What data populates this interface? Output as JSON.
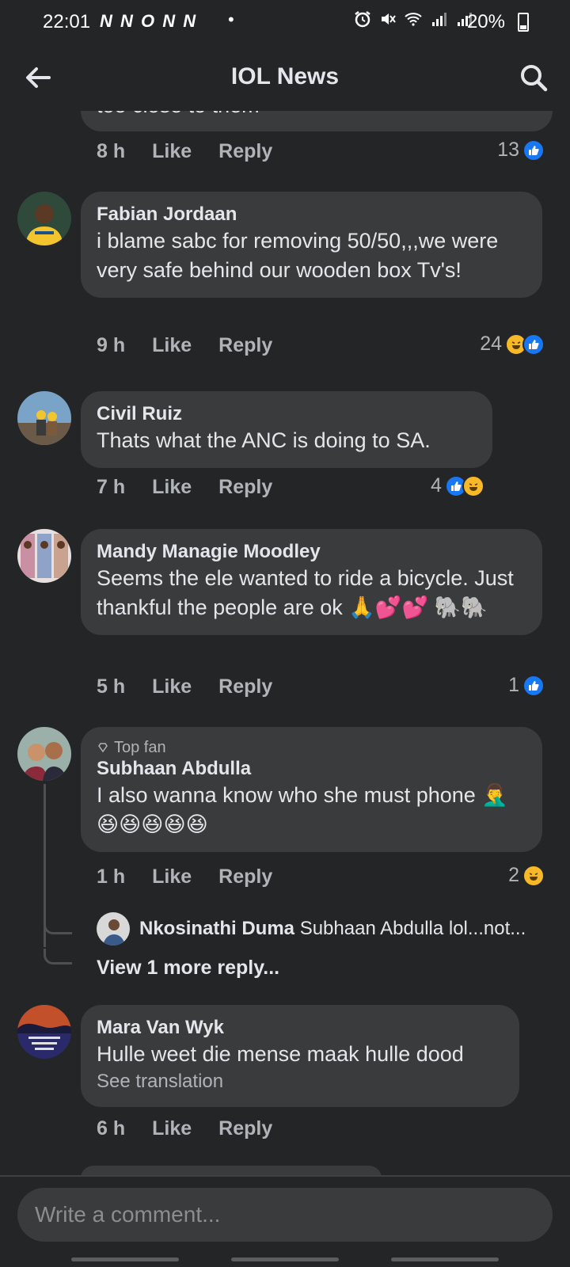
{
  "status_bar": {
    "time": "22:01",
    "app_icons": "N N O N N",
    "dot": "•",
    "battery_percent": "20%"
  },
  "header": {
    "title": "IOL News"
  },
  "partial_comment": {
    "text_fragment": "too close to them",
    "time": "8 h",
    "like_label": "Like",
    "reply_label": "Reply",
    "reaction_count": "13",
    "reactions": [
      "like"
    ]
  },
  "comments": [
    {
      "author": "Fabian Jordaan",
      "text": "i blame sabc for removing 50/50,,,we were very safe behind our wooden box Tv's!",
      "time": "9 h",
      "like_label": "Like",
      "reply_label": "Reply",
      "reaction_count": "24",
      "reactions": [
        "haha",
        "like"
      ]
    },
    {
      "author": "Civil Ruiz",
      "text": "Thats what the ANC is doing to SA.",
      "time": "7 h",
      "like_label": "Like",
      "reply_label": "Reply",
      "reaction_count": "4",
      "reactions": [
        "like",
        "haha"
      ]
    },
    {
      "author": "Mandy Managie Moodley",
      "text": "Seems the ele wanted to ride a bicycle. Just thankful the  people are ok 🙏💕💕 🐘🐘",
      "time": "5 h",
      "like_label": "Like",
      "reply_label": "Reply",
      "reaction_count": "1",
      "reactions": [
        "like"
      ]
    },
    {
      "badge": "Top fan",
      "author": "Subhaan Abdulla",
      "text": "I also wanna know who she must phone 🤦‍♂️😆😆😆😆😆",
      "time": "1 h",
      "like_label": "Like",
      "reply_label": "Reply",
      "reaction_count": "2",
      "reactions": [
        "haha"
      ],
      "reply_preview": {
        "author": "Nkosinathi Duma",
        "text": "Subhaan Abdulla lol...not..."
      },
      "view_more": "View 1 more reply..."
    },
    {
      "author": "Mara Van Wyk",
      "text": "Hulle weet die mense maak hulle dood",
      "see_translation": "See translation",
      "time": "6 h",
      "like_label": "Like",
      "reply_label": "Reply"
    }
  ],
  "composer": {
    "placeholder": "Write a comment..."
  },
  "colors": {
    "background": "#242526",
    "bubble": "#3a3b3c",
    "text_primary": "#e4e6eb",
    "text_secondary": "#b0b3b8",
    "like_blue": "#1877f2",
    "haha_yellow": "#f7b928"
  }
}
